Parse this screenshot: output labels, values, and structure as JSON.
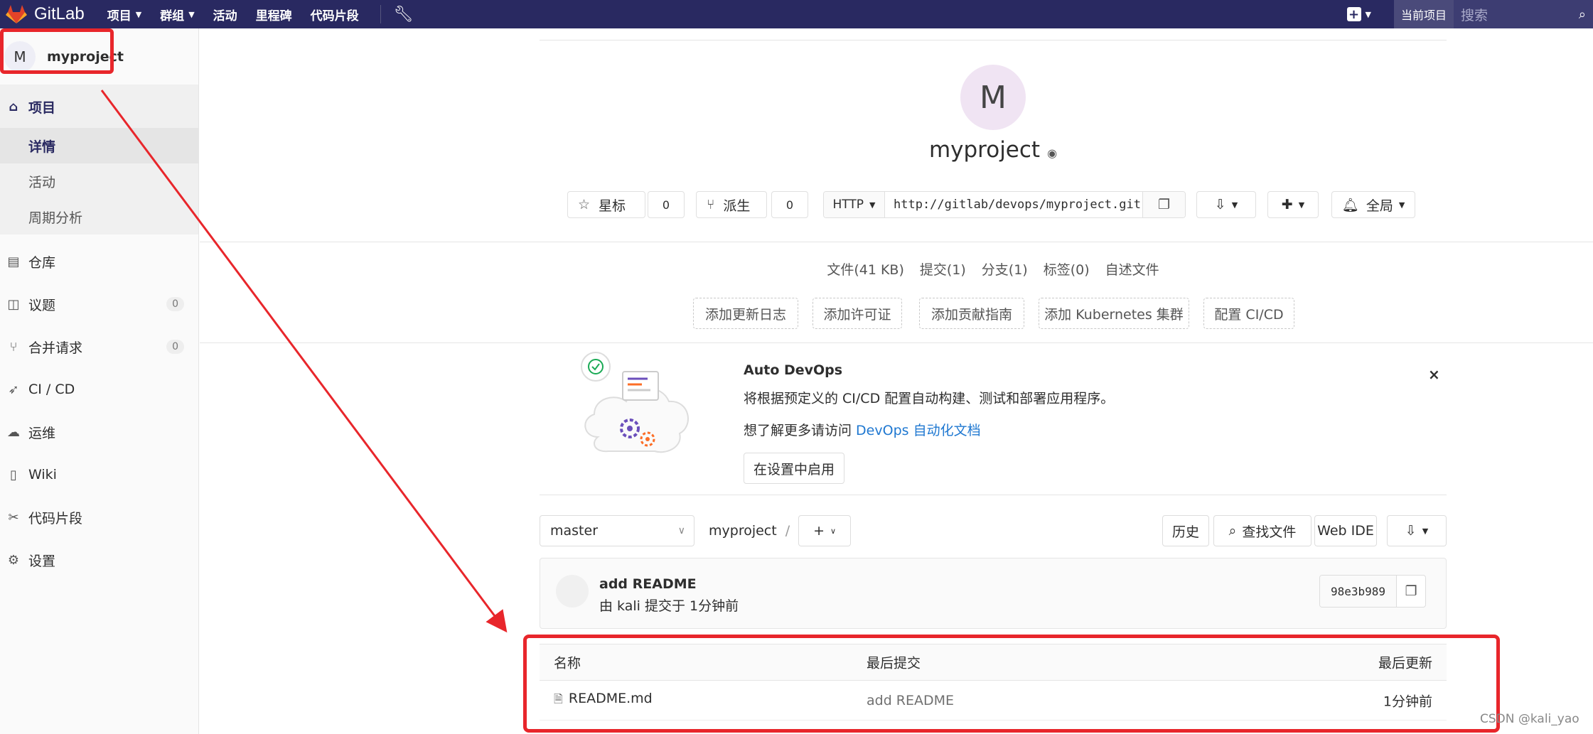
{
  "topbar": {
    "brand": "GitLab",
    "nav": [
      "项目",
      "群组",
      "活动",
      "里程碑",
      "代码片段"
    ],
    "scope": "当前项目",
    "search_placeholder": "搜索"
  },
  "sidebar": {
    "avatar_letter": "M",
    "project_name": "myproject",
    "main_item": "项目",
    "sub_items": [
      "详情",
      "活动",
      "周期分析"
    ],
    "items": [
      {
        "label": "仓库",
        "count": ""
      },
      {
        "label": "议题",
        "count": "0"
      },
      {
        "label": "合并请求",
        "count": "0"
      },
      {
        "label": "CI / CD",
        "count": ""
      },
      {
        "label": "运维",
        "count": ""
      },
      {
        "label": "Wiki",
        "count": ""
      },
      {
        "label": "代码片段",
        "count": ""
      },
      {
        "label": "设置",
        "count": ""
      }
    ]
  },
  "project": {
    "avatar_letter": "M",
    "name": "myproject",
    "star_label": "星标",
    "star_count": "0",
    "fork_label": "派生",
    "fork_count": "0",
    "protocol": "HTTP",
    "clone_url": "http://gitlab/devops/myproject.git",
    "notify_label": "全局"
  },
  "stats": [
    "文件(41 KB)",
    "提交(1)",
    "分支(1)",
    "标签(0)",
    "自述文件"
  ],
  "suggestions": [
    "添加更新日志",
    "添加许可证",
    "添加贡献指南",
    "添加 Kubernetes 集群",
    "配置 CI/CD"
  ],
  "devops": {
    "title": "Auto DevOps",
    "description": "将根据预定义的 CI/CD 配置自动构建、测试和部署应用程序。",
    "more_prefix": "想了解更多请访问 ",
    "more_link": "DevOps 自动化文档",
    "enable_button": "在设置中启用",
    "close": "×"
  },
  "tree": {
    "branch": "master",
    "path_root": "myproject",
    "history": "历史",
    "find_file": "查找文件",
    "web_ide": "Web IDE"
  },
  "commit": {
    "title": "add README",
    "subtitle": "由 kali 提交于 1分钟前",
    "sha": "98e3b989"
  },
  "table": {
    "headers": [
      "名称",
      "最后提交",
      "最后更新"
    ],
    "rows": [
      {
        "name": "README.md",
        "last_commit": "add README",
        "updated": "1分钟前"
      }
    ]
  },
  "watermark": "CSDN @kali_yao",
  "colors": {
    "navbar": "#292961",
    "annotation": "#e8262b",
    "link": "#1f78d1"
  }
}
